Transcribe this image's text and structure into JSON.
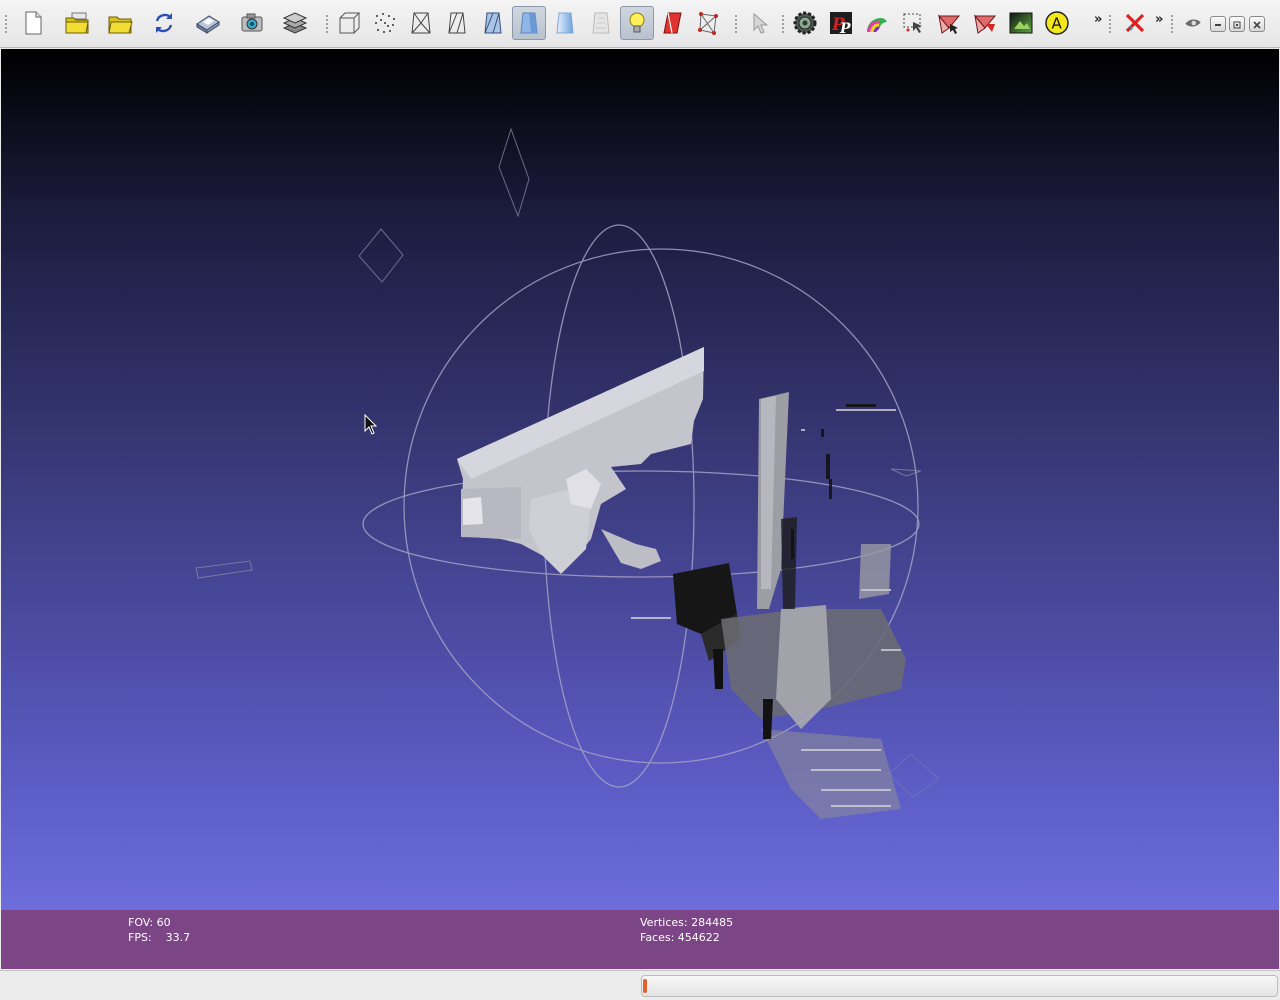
{
  "toolbar": {
    "buttons": [
      {
        "icon": "new-document-icon"
      },
      {
        "icon": "open-project-icon"
      },
      {
        "icon": "open-mesh-icon"
      },
      {
        "icon": "reload-icon"
      },
      {
        "icon": "save-icon"
      },
      {
        "icon": "snapshot-camera-icon"
      },
      {
        "icon": "layers-icon"
      },
      {
        "icon": "bounding-box-icon"
      },
      {
        "icon": "points-icon"
      },
      {
        "icon": "wireframe-icon"
      },
      {
        "icon": "hidden-lines-icon"
      },
      {
        "icon": "flat-lines-icon"
      },
      {
        "icon": "flat-shading-icon",
        "active": true
      },
      {
        "icon": "smooth-shading-icon"
      },
      {
        "icon": "texture-icon"
      },
      {
        "icon": "light-bulb-icon",
        "active": true
      },
      {
        "icon": "backface-culling-icon"
      },
      {
        "icon": "select-vertices-icon"
      },
      {
        "icon": "pointer-select-icon"
      },
      {
        "icon": "decorate-gear-icon"
      },
      {
        "icon": "pp-plugin-icon"
      },
      {
        "icon": "quality-colorize-icon"
      },
      {
        "icon": "select-region-icon"
      },
      {
        "icon": "select-faces-icon"
      },
      {
        "icon": "delete-faces-icon"
      },
      {
        "icon": "image-layer-icon"
      },
      {
        "icon": "annotation-a-icon"
      },
      {
        "icon": "delete-selection-icon"
      },
      {
        "icon": "eye-icon"
      }
    ],
    "overflow_label": "»"
  },
  "window_controls": [
    "minimize-icon",
    "restore-icon",
    "close-icon"
  ],
  "info": {
    "fov_line": "FOV: 60",
    "fps_line": "FPS:    33.7",
    "vertices_line": "Vertices: 284485",
    "faces_line": "Faces: 454622"
  },
  "colors": {
    "viewport_top": "#000000",
    "viewport_bottom": "#7574e6",
    "info_bar": "#7c4585",
    "progress_fill": "#e06030"
  },
  "status": {
    "progress": 0.005
  }
}
